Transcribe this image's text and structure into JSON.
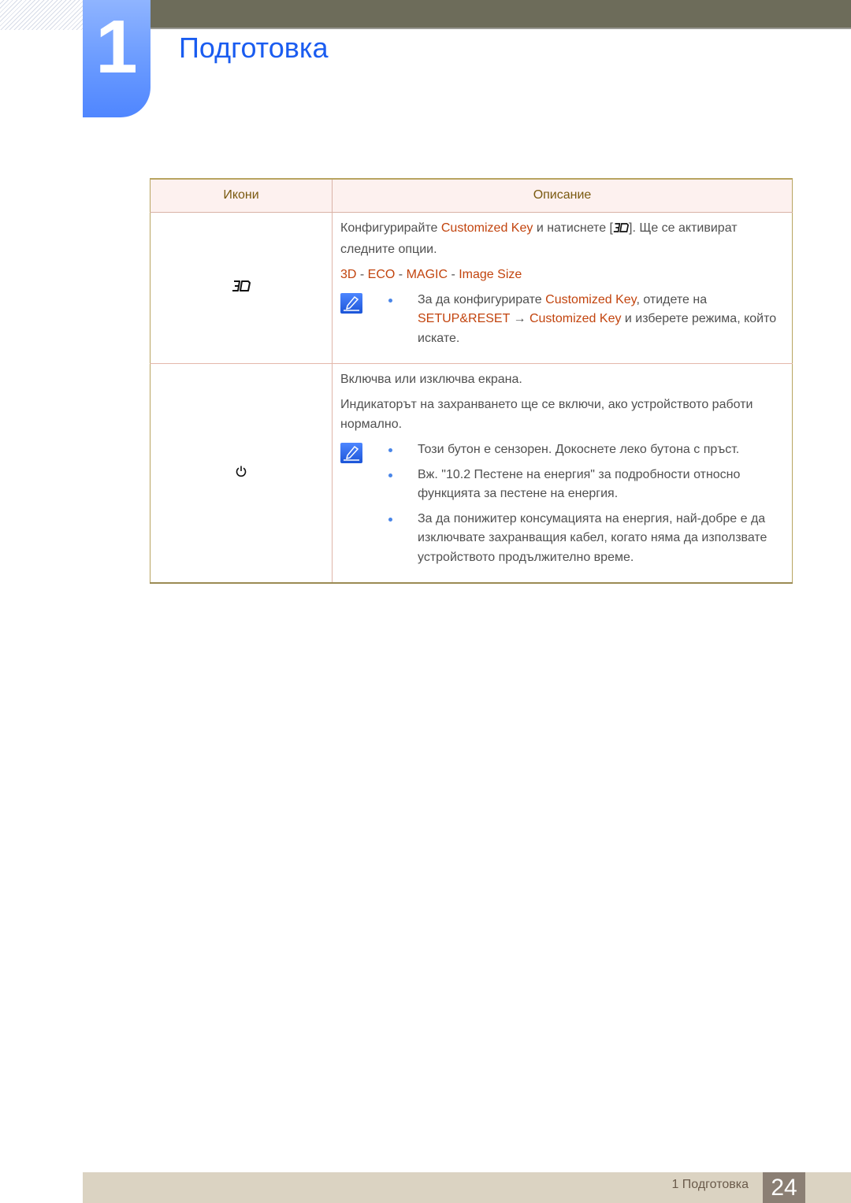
{
  "header": {
    "chapter_number": "1",
    "chapter_title": "Подготовка"
  },
  "table": {
    "columns": [
      "Икони",
      "Описание"
    ],
    "rows": [
      {
        "icon": "3d-icon",
        "description": {
          "intro_prefix": "Конфигурирайте ",
          "intro_highlight": "Customized Key",
          "intro_middle": " и натиснете [",
          "intro_suffix": "]. Ще се активират следните опции.",
          "options": {
            "o1": "3D",
            "o2": "ECO",
            "o3": "MAGIC",
            "o4": "Image Size",
            "separator": " - "
          },
          "notes": [
            {
              "prefix": "За да конфигурирате ",
              "hl1": "Customized Key",
              "mid1": ", отидете на ",
              "hl2": "SETUP&RESET",
              "arrow": " → ",
              "hl3": "Customized Key",
              "suffix": " и изберете режима, който искате."
            }
          ]
        }
      },
      {
        "icon": "power-icon",
        "description": {
          "p1": "Включва или изключва екрана.",
          "p2": "Индикаторът на захранването ще се включи, ако устройството работи нормално.",
          "notes": [
            "Този бутон е сензорен. Докоснете леко бутона с пръст.",
            "Вж. \"10.2 Пестене на енергия\" за подробности относно функцията за пестене на енергия.",
            "За да понижитер консумацията на енергия, най-добре е да изключвате захранващия кабел, когато няма да използвате устройството продължително време."
          ]
        }
      }
    ]
  },
  "footer": {
    "section_label": "1 Подготовка",
    "page_number": "24"
  }
}
